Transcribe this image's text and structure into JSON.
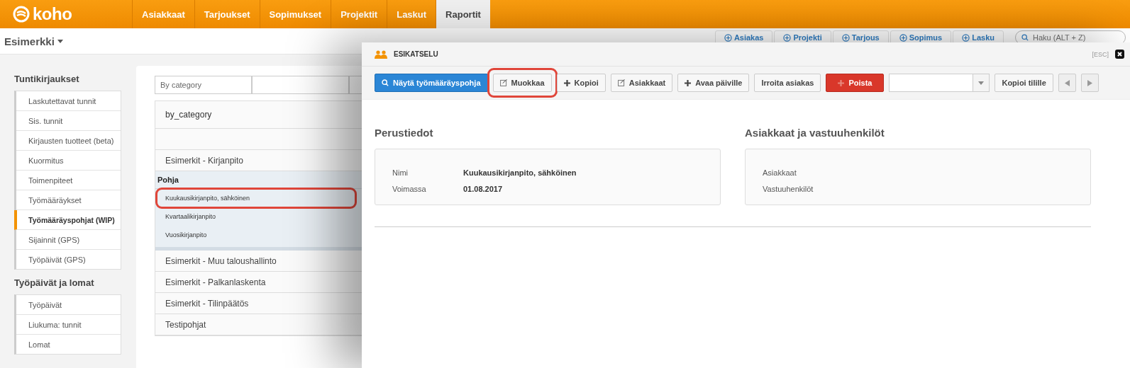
{
  "topbar": {
    "logo": "koho",
    "nav": [
      {
        "label": "Asiakkaat",
        "selected": false
      },
      {
        "label": "Tarjoukset",
        "selected": false
      },
      {
        "label": "Sopimukset",
        "selected": false
      },
      {
        "label": "Projektit",
        "selected": false
      },
      {
        "label": "Laskut",
        "selected": false
      },
      {
        "label": "Raportit",
        "selected": true
      }
    ]
  },
  "subheader": {
    "company": "Esimerkki",
    "quick_links": [
      "Asiakas",
      "Projekti",
      "Tarjous",
      "Sopimus",
      "Lasku"
    ],
    "search": {
      "placeholder": "Haku (ALT + Z)"
    }
  },
  "sidebar": [
    {
      "heading": "Tuntikirjaukset",
      "items": [
        {
          "label": "Laskutettavat tunnit",
          "selected": false
        },
        {
          "label": "Sis. tunnit",
          "selected": false
        },
        {
          "label": "Kirjausten tuotteet (beta)",
          "selected": false
        },
        {
          "label": "Kuormitus",
          "selected": false
        },
        {
          "label": "Toimenpiteet",
          "selected": false
        },
        {
          "label": "Työmääräykset",
          "selected": false
        },
        {
          "label": "Työmääräyspohjat (WIP)",
          "selected": true
        },
        {
          "label": "Sijainnit (GPS)",
          "selected": false
        },
        {
          "label": "Työpäivät (GPS)",
          "selected": false
        }
      ]
    },
    {
      "heading": "Työpäivät ja lomat",
      "items": [
        {
          "label": "Työpäivät",
          "selected": false
        },
        {
          "label": "Liukuma: tunnit",
          "selected": false
        },
        {
          "label": "Lomat",
          "selected": false
        }
      ]
    }
  ],
  "filter": {
    "value": "By category"
  },
  "table": {
    "header": "by_category",
    "rows": [
      {
        "label": "Esimerkit - Kirjanpito",
        "group": "Pohja",
        "children": [
          {
            "label": "Kuukausikirjanpito, sähköinen",
            "highlighted": true
          },
          {
            "label": "Kvartaalikirjanpito",
            "highlighted": false
          },
          {
            "label": "Vuosikirjanpito",
            "highlighted": false
          }
        ]
      },
      {
        "label": "Esimerkit - Muu taloushallinto"
      },
      {
        "label": "Esimerkit - Palkanlaskenta"
      },
      {
        "label": "Esimerkit - Tilinpäätös"
      },
      {
        "label": "Testipohjat"
      }
    ]
  },
  "modal": {
    "title": "ESIKATSELU",
    "esc": "[ESC]",
    "toolbar": [
      {
        "label": "Näytä työmääräyspohja",
        "kind": "primary",
        "highlighted": false
      },
      {
        "label": "Muokkaa",
        "kind": "edit",
        "highlighted": true
      },
      {
        "label": "Kopioi",
        "kind": "add",
        "highlighted": false
      },
      {
        "label": "Asiakkaat",
        "kind": "edit",
        "highlighted": false
      },
      {
        "label": "Avaa päiville",
        "kind": "add",
        "highlighted": false
      },
      {
        "label": "Irroita asiakas",
        "kind": "plain",
        "highlighted": false
      },
      {
        "label": "Poista",
        "kind": "danger",
        "highlighted": false
      },
      {
        "kind": "select"
      },
      {
        "label": "Kopioi tilille",
        "kind": "plain",
        "highlighted": false
      },
      {
        "kind": "prev"
      },
      {
        "kind": "next"
      }
    ],
    "sections": [
      {
        "title": "Perustiedot",
        "fields": [
          {
            "label": "Nimi",
            "value": "Kuukausikirjanpito, sähköinen"
          },
          {
            "label": "Voimassa",
            "value": "01.08.2017"
          }
        ]
      },
      {
        "title": "Asiakkaat ja vastuuhenkilöt",
        "fields": [
          {
            "label": "Asiakkaat"
          },
          {
            "label": "Vastuuhenkilöt"
          }
        ]
      }
    ]
  }
}
